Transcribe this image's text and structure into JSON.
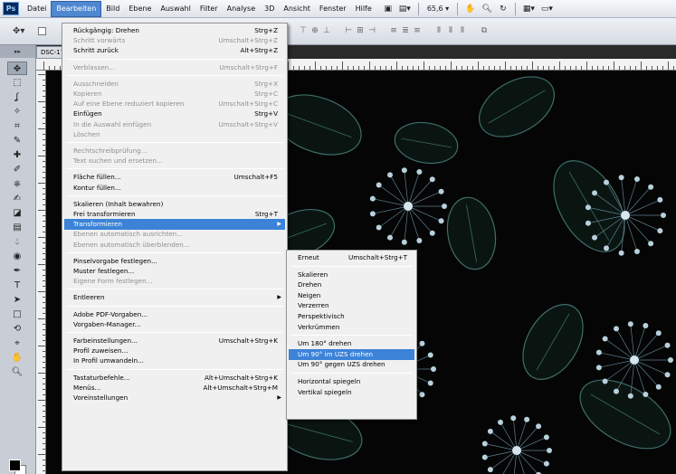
{
  "app": {
    "logo": "Ps"
  },
  "menubar": {
    "items": [
      "Datei",
      "Bearbeiten",
      "Bild",
      "Ebene",
      "Auswahl",
      "Filter",
      "Analyse",
      "3D",
      "Ansicht",
      "Fenster",
      "Hilfe"
    ],
    "zoom": "65,6"
  },
  "document": {
    "tab_title": "DSC-17"
  },
  "edit_menu": {
    "items": [
      {
        "label": "Rückgängig: Drehen",
        "shortcut": "Strg+Z",
        "state": "enabled"
      },
      {
        "label": "Schritt vorwärts",
        "shortcut": "Umschalt+Strg+Z",
        "state": "disabled"
      },
      {
        "label": "Schritt zurück",
        "shortcut": "Alt+Strg+Z",
        "state": "enabled"
      },
      {
        "sep": true
      },
      {
        "label": "Verblassen...",
        "shortcut": "Umschalt+Strg+F",
        "state": "disabled"
      },
      {
        "sep": true
      },
      {
        "label": "Ausschneiden",
        "shortcut": "Strg+X",
        "state": "disabled"
      },
      {
        "label": "Kopieren",
        "shortcut": "Strg+C",
        "state": "disabled"
      },
      {
        "label": "Auf eine Ebene reduziert kopieren",
        "shortcut": "Umschalt+Strg+C",
        "state": "disabled"
      },
      {
        "label": "Einfügen",
        "shortcut": "Strg+V",
        "state": "enabled"
      },
      {
        "label": "In die Auswahl einfügen",
        "shortcut": "Umschalt+Strg+V",
        "state": "disabled"
      },
      {
        "label": "Löschen",
        "shortcut": "",
        "state": "disabled"
      },
      {
        "sep": true
      },
      {
        "label": "Rechtschreibprüfung...",
        "shortcut": "",
        "state": "disabled"
      },
      {
        "label": "Text suchen und ersetzen...",
        "shortcut": "",
        "state": "disabled"
      },
      {
        "sep": true
      },
      {
        "label": "Fläche füllen...",
        "shortcut": "Umschalt+F5",
        "state": "enabled"
      },
      {
        "label": "Kontur füllen...",
        "shortcut": "",
        "state": "enabled"
      },
      {
        "sep": true
      },
      {
        "label": "Skalieren (Inhalt bewahren)",
        "shortcut": "",
        "state": "enabled"
      },
      {
        "label": "Frei transformieren",
        "shortcut": "Strg+T",
        "state": "enabled"
      },
      {
        "label": "Transformieren",
        "shortcut": "",
        "state": "highlighted",
        "submenu": true
      },
      {
        "label": "Ebenen automatisch ausrichten...",
        "shortcut": "",
        "state": "disabled"
      },
      {
        "label": "Ebenen automatisch überblenden...",
        "shortcut": "",
        "state": "disabled"
      },
      {
        "sep": true
      },
      {
        "label": "Pinselvorgabe festlegen...",
        "shortcut": "",
        "state": "enabled"
      },
      {
        "label": "Muster festlegen...",
        "shortcut": "",
        "state": "enabled"
      },
      {
        "label": "Eigene Form festlegen...",
        "shortcut": "",
        "state": "disabled"
      },
      {
        "sep": true
      },
      {
        "label": "Entleeren",
        "shortcut": "",
        "state": "enabled",
        "submenu": true
      },
      {
        "sep": true
      },
      {
        "label": "Adobe PDF-Vorgaben...",
        "shortcut": "",
        "state": "enabled"
      },
      {
        "label": "Vorgaben-Manager...",
        "shortcut": "",
        "state": "enabled"
      },
      {
        "sep": true
      },
      {
        "label": "Farbeinstellungen...",
        "shortcut": "Umschalt+Strg+K",
        "state": "enabled"
      },
      {
        "label": "Profil zuweisen...",
        "shortcut": "",
        "state": "enabled"
      },
      {
        "label": "In Profil umwandeln...",
        "shortcut": "",
        "state": "enabled"
      },
      {
        "sep": true
      },
      {
        "label": "Tastaturbefehle...",
        "shortcut": "Alt+Umschalt+Strg+K",
        "state": "enabled"
      },
      {
        "label": "Menüs...",
        "shortcut": "Alt+Umschalt+Strg+M",
        "state": "enabled"
      },
      {
        "label": "Voreinstellungen",
        "shortcut": "",
        "state": "enabled",
        "submenu": true
      }
    ]
  },
  "transform_menu": {
    "items": [
      {
        "label": "Erneut",
        "shortcut": "Umschalt+Strg+T",
        "state": "enabled"
      },
      {
        "sep": true
      },
      {
        "label": "Skalieren",
        "shortcut": "",
        "state": "enabled"
      },
      {
        "label": "Drehen",
        "shortcut": "",
        "state": "enabled"
      },
      {
        "label": "Neigen",
        "shortcut": "",
        "state": "enabled"
      },
      {
        "label": "Verzerren",
        "shortcut": "",
        "state": "enabled"
      },
      {
        "label": "Perspektivisch",
        "shortcut": "",
        "state": "enabled"
      },
      {
        "label": "Verkrümmen",
        "shortcut": "",
        "state": "enabled"
      },
      {
        "sep": true
      },
      {
        "label": "Um 180° drehen",
        "shortcut": "",
        "state": "enabled"
      },
      {
        "label": "Um 90° im UZS drehen",
        "shortcut": "",
        "state": "highlighted"
      },
      {
        "label": "Um 90° gegen UZS drehen",
        "shortcut": "",
        "state": "enabled"
      },
      {
        "sep": true
      },
      {
        "label": "Horizontal spiegeln",
        "shortcut": "",
        "state": "enabled"
      },
      {
        "label": "Vertikal spiegeln",
        "shortcut": "",
        "state": "enabled"
      }
    ]
  },
  "icons": [
    "move-tool-icon",
    "marquee-tool-icon",
    "lasso-tool-icon",
    "quick-select-icon",
    "crop-tool-icon",
    "eyedropper-icon",
    "healing-brush-icon",
    "brush-tool-icon",
    "clone-stamp-icon",
    "history-brush-icon",
    "eraser-icon",
    "gradient-icon",
    "blur-tool-icon",
    "dodge-tool-icon",
    "pen-tool-icon",
    "type-tool-icon",
    "path-select-icon",
    "shape-tool-icon",
    "3d-rotate-icon",
    "3d-camera-icon",
    "hand-tool-icon",
    "zoom-tool-icon"
  ],
  "colors": {
    "highlight": "#3c83d8",
    "menu_bg": "#f0f0f0",
    "disabled_text": "#8f8f8f",
    "foreground": "#000000",
    "background": "#ffffff"
  }
}
